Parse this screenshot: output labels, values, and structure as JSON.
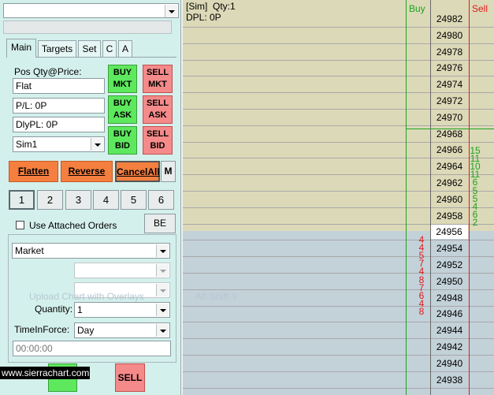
{
  "trade_window": {
    "symbol_value": "",
    "tabs": [
      {
        "label": "Main",
        "active": true
      },
      {
        "label": "Targets",
        "active": false
      },
      {
        "label": "Set",
        "active": false
      },
      {
        "label": "C",
        "active": false
      },
      {
        "label": "A",
        "active": false
      }
    ],
    "position": {
      "label": "Pos Qty@Price:",
      "value": "Flat",
      "pl": "P/L: 0P",
      "daily_pl": "DlyPL: 0P",
      "account": "Sim1"
    },
    "buttons": {
      "buy_mkt": [
        "BUY",
        "MKT"
      ],
      "sell_mkt": [
        "SELL",
        "MKT"
      ],
      "buy_ask": [
        "BUY",
        "ASK"
      ],
      "sell_ask": [
        "SELL",
        "ASK"
      ],
      "buy_bid": [
        "BUY",
        "BID"
      ],
      "sell_bid": [
        "SELL",
        "BID"
      ],
      "flatten": "Flatten",
      "reverse": "Reverse",
      "cancel_all": "CancelAll",
      "m": "M",
      "be": "BE",
      "sell": "SELL"
    },
    "quantity_presets": [
      "1",
      "2",
      "3",
      "4",
      "5",
      "6"
    ],
    "selected_preset": "1",
    "use_attached_orders": {
      "label": "Use Attached Orders",
      "checked": false
    },
    "order_type": "Market",
    "quantity": {
      "label": "Quantity:",
      "value": "1"
    },
    "time_in_force": {
      "label": "TimeInForce:",
      "value": "Day"
    },
    "time_value": "00:00:00"
  },
  "watermarks": {
    "upload": "Upload Chart with Overlays",
    "shortcut": "Alt-Shift-9",
    "site": "www.sierrachart.com"
  },
  "ladder": {
    "header": {
      "account": "[Sim]",
      "qty": "Qty:1",
      "dpl": "DPL: 0P",
      "buy": "Buy",
      "sell": "Sell"
    },
    "current_price": "24956",
    "prices": [
      "24982",
      "24980",
      "24978",
      "24976",
      "24974",
      "24972",
      "24970",
      "24968",
      "24966",
      "24964",
      "24962",
      "24960",
      "24958",
      "24956",
      "24954",
      "24952",
      "24950",
      "24948",
      "24946",
      "24944",
      "24942",
      "24940",
      "24938"
    ],
    "ask_sizes": [
      "15",
      "11",
      "10",
      "11",
      "6",
      "5",
      "5",
      "4",
      "6",
      "2"
    ],
    "bid_sizes": [
      "4",
      "4",
      "5",
      "7",
      "4",
      "8",
      "7",
      "6",
      "4",
      "8"
    ]
  },
  "colors": {
    "upper_ladder_bg": "#dcd9b8",
    "lower_ladder_bg": "#c3d1d9",
    "buy_green": "#1fa21f",
    "sell_red": "#e01b1b",
    "button_green": "#5de85d",
    "button_red": "#f58a8a",
    "button_orange": "#f57f3f",
    "panel_bg": "#d4f0ec"
  }
}
